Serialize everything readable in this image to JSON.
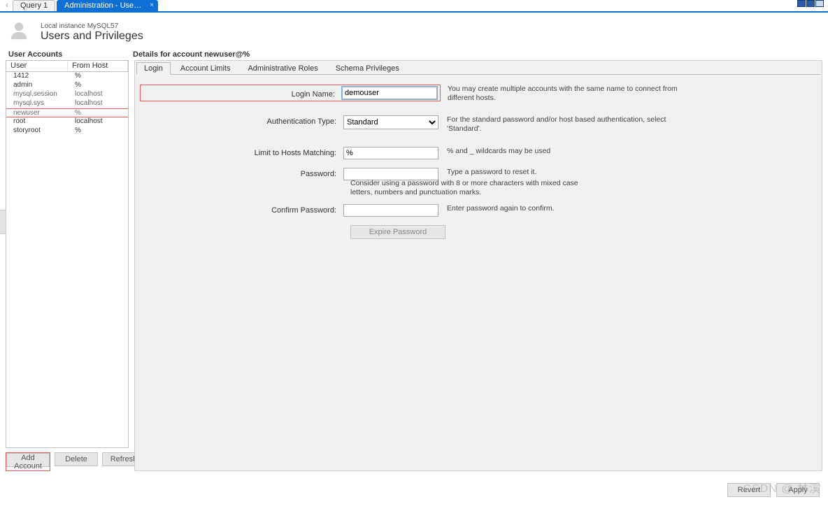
{
  "top_tabs": {
    "left_arrow": "‹",
    "t1": "Query 1",
    "t2": "Administration - Users and Privil…"
  },
  "header": {
    "sub": "Local instance MySQL57",
    "title": "Users and Privileges"
  },
  "left": {
    "section": "User Accounts",
    "col_user": "User",
    "col_host": "From Host",
    "rows": [
      {
        "user": "1412",
        "host": "%"
      },
      {
        "user": "admin",
        "host": "%"
      },
      {
        "user": "mysql.session",
        "host": "localhost"
      },
      {
        "user": "mysql.sys",
        "host": "localhost"
      },
      {
        "user": "newuser",
        "host": "%"
      },
      {
        "user": "root",
        "host": "localhost"
      },
      {
        "user": "storyroot",
        "host": "%"
      }
    ],
    "buttons": {
      "add": "Add Account",
      "del": "Delete",
      "refresh": "Refresh"
    }
  },
  "right": {
    "section": "Details for account newuser@%",
    "tabs": {
      "login": "Login",
      "limits": "Account Limits",
      "roles": "Administrative Roles",
      "schema": "Schema Privileges"
    },
    "login_form": {
      "login_name_lbl": "Login Name:",
      "login_name_val": "demouser",
      "login_name_hint": "You may create multiple accounts with the same name to connect from different hosts.",
      "auth_lbl": "Authentication Type:",
      "auth_val": "Standard",
      "auth_hint": "For the standard password and/or host based authentication, select 'Standard'.",
      "hosts_lbl": "Limit to Hosts Matching:",
      "hosts_val": "%",
      "hosts_hint": "% and _ wildcards may be used",
      "pw_lbl": "Password:",
      "pw_val": "",
      "pw_hint": "Type a password to reset it.",
      "pw_hint2": "Consider using a password with 8 or more characters with mixed case letters, numbers and punctuation marks.",
      "cpw_lbl": "Confirm Password:",
      "cpw_val": "",
      "cpw_hint": "Enter password again to confirm.",
      "expire_btn": "Expire Password"
    },
    "buttons": {
      "revert": "Revert",
      "apply": "Apply"
    }
  },
  "watermark": "CSDN @ 林溪"
}
